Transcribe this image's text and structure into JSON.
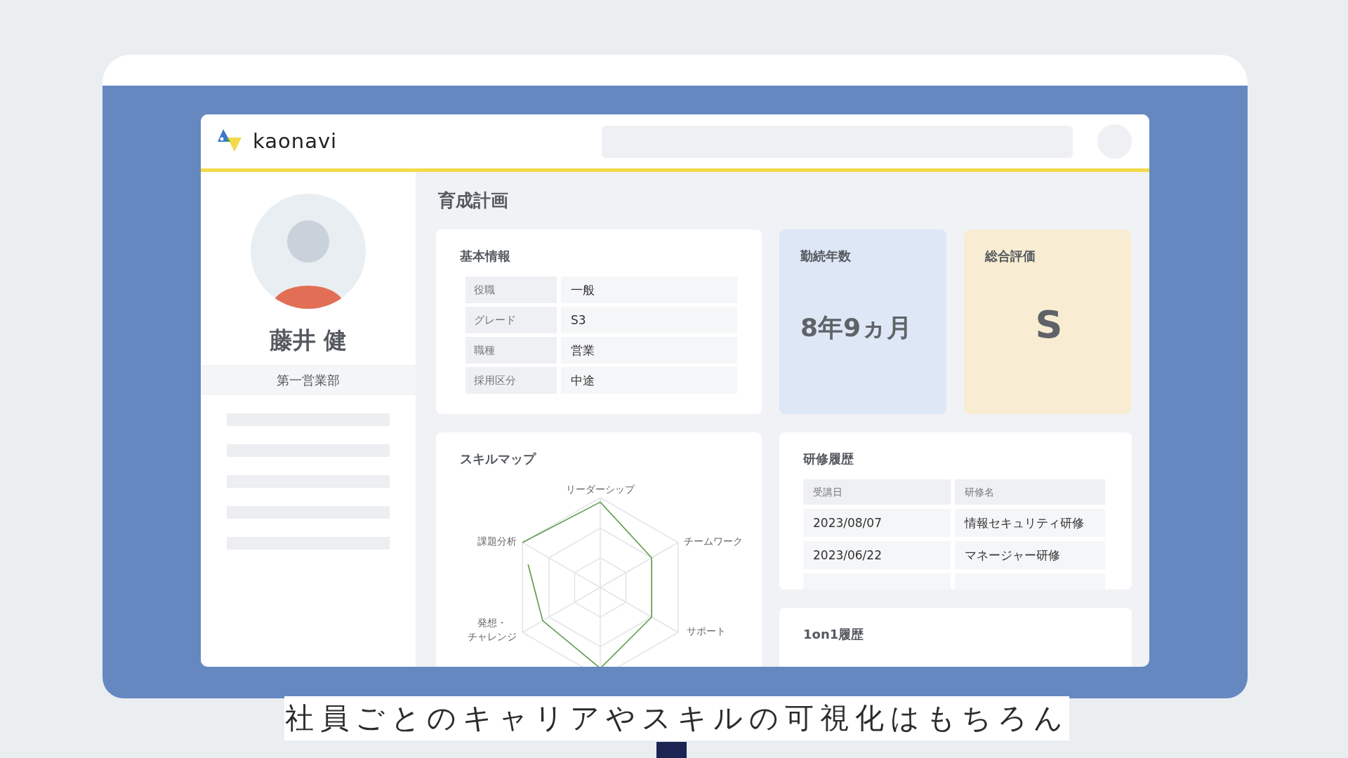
{
  "app": {
    "logo_text": "kaonavi"
  },
  "profile": {
    "name": "藤井 健",
    "department": "第一営業部"
  },
  "page_title": "育成計画",
  "basic_info": {
    "title": "基本情報",
    "rows": [
      {
        "label": "役職",
        "value": "一般"
      },
      {
        "label": "グレード",
        "value": "S3"
      },
      {
        "label": "職種",
        "value": "営業"
      },
      {
        "label": "採用区分",
        "value": "中途"
      }
    ]
  },
  "stats": [
    {
      "kind": "tenure",
      "title": "勤続年数",
      "value": "8年9ヵ月",
      "color": "#dde7f5"
    },
    {
      "kind": "rating",
      "title": "総合評価",
      "value": "S",
      "color": "#f8edd2"
    }
  ],
  "skill_map": {
    "title": "スキルマップ",
    "axes": [
      {
        "lines": [
          "リーダーシップ"
        ]
      },
      {
        "lines": [
          "課題分析"
        ]
      },
      {
        "lines": [
          "チームワーク"
        ]
      },
      {
        "lines": [
          "発想・",
          "チャレンジ"
        ]
      },
      {
        "lines": [
          "サポート"
        ]
      }
    ]
  },
  "training": {
    "title": "研修履歴",
    "columns": [
      "受講日",
      "研修名"
    ],
    "rows": [
      [
        "2023/08/07",
        "情報セキュリティ研修"
      ],
      [
        "2023/06/22",
        "マネージャー研修"
      ]
    ]
  },
  "one_on_one": {
    "title": "1on1履歴"
  },
  "caption": "社員ごとのキャリアやスキルの可視化はもちろん"
}
